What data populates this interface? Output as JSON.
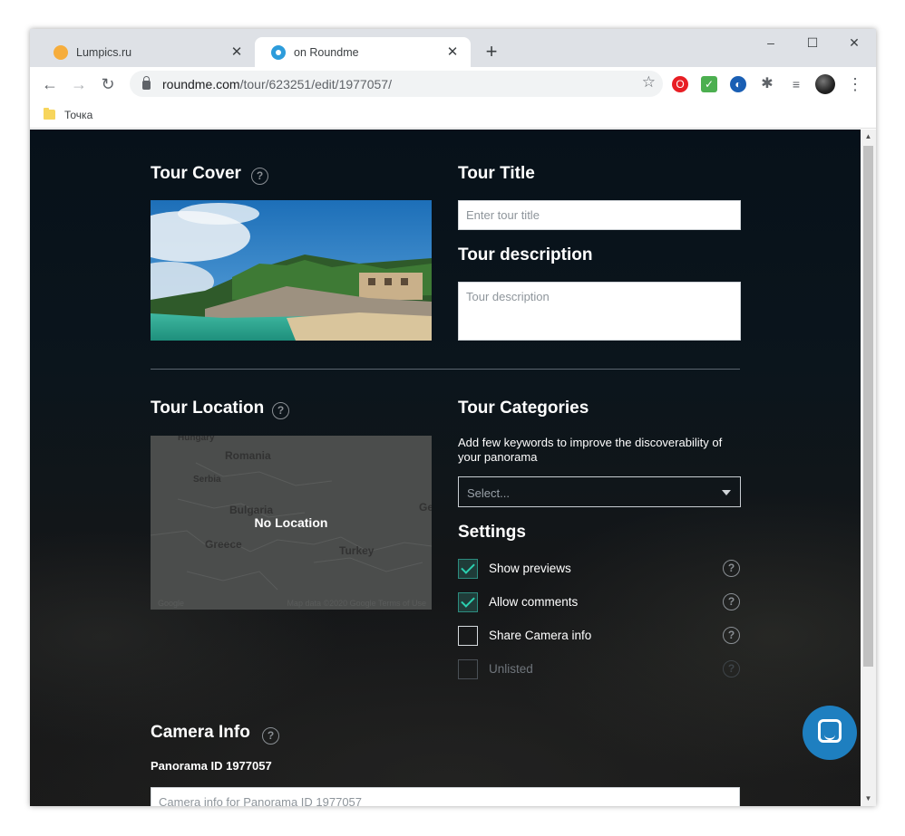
{
  "browser": {
    "tabs": [
      {
        "title": "Lumpics.ru",
        "active": false
      },
      {
        "title": "on Roundme",
        "active": true
      }
    ],
    "new_tab": "+",
    "window_controls": {
      "minimize": "–",
      "maximize": "☐",
      "close": "✕"
    },
    "url_host": "roundme.com",
    "url_path": "/tour/623251/edit/1977057/",
    "bookmarks": [
      {
        "label": "Точка"
      }
    ]
  },
  "page": {
    "tour_cover": {
      "title": "Tour Cover"
    },
    "tour_title": {
      "title": "Tour Title",
      "placeholder": "Enter tour title"
    },
    "tour_description": {
      "title": "Tour description",
      "placeholder": "Tour description"
    },
    "tour_location": {
      "title": "Tour Location",
      "map_labels": [
        "Hungary",
        "Romania",
        "Serbia",
        "Bulgaria",
        "Greece",
        "Turkey",
        "Ge"
      ],
      "status": "No Location",
      "map_footer_left": "Google",
      "map_footer_right": "Map data ©2020 Google   Terms of Use"
    },
    "tour_categories": {
      "title": "Tour Categories",
      "hint": "Add few keywords to improve the discoverability of your panorama",
      "select_placeholder": "Select..."
    },
    "settings": {
      "title": "Settings",
      "items": [
        {
          "label": "Show previews",
          "checked": true,
          "disabled": false
        },
        {
          "label": "Allow comments",
          "checked": true,
          "disabled": false
        },
        {
          "label": "Share Camera info",
          "checked": false,
          "disabled": false
        },
        {
          "label": "Unlisted",
          "checked": false,
          "disabled": true
        }
      ]
    },
    "camera_info": {
      "title": "Camera Info",
      "panorama_id_label": "Panorama ID 1977057",
      "placeholder": "Camera info for Panorama ID 1977057"
    },
    "help_glyph": "?"
  },
  "colors": {
    "accent_check": "#2bd0b0",
    "chat_button": "#1e7fc0",
    "page_background": "#0b151c"
  }
}
